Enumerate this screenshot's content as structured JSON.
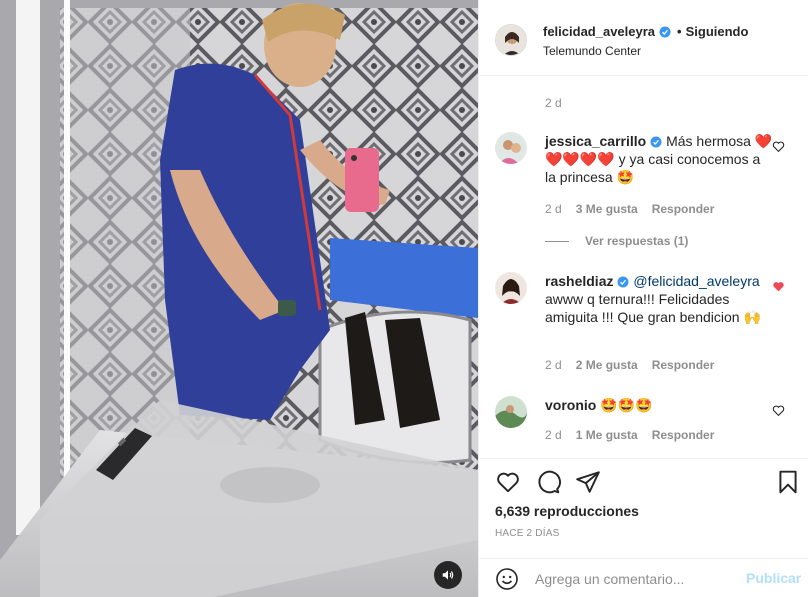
{
  "post": {
    "username": "felicidad_aveleyra",
    "separator": "•",
    "follow_status": "Siguiendo",
    "location": "Telemundo Center"
  },
  "comments_top_meta": {
    "time": "2 d"
  },
  "comments": [
    {
      "username": "jessica_carrillo",
      "text_before": "Más hermosa ",
      "emoji_line": "❤️❤️❤️❤️❤️",
      "text_after": " y ya casi conocemos a la princesa 🤩",
      "time": "2 d",
      "likes": "3 Me gusta",
      "reply": "Responder",
      "view_replies": "Ver respuestas (1)",
      "liked": false
    },
    {
      "username": "rasheldiaz",
      "mention": "@felicidad_aveleyra",
      "text": "awww q ternura!!! Felicidades amiguita !!! Que gran bendicion 🙌",
      "time": "2 d",
      "likes": "2 Me gusta",
      "reply": "Responder",
      "liked": true
    },
    {
      "username": "voronio",
      "text": "🤩🤩🤩",
      "time": "2 d",
      "likes": "1 Me gusta",
      "reply": "Responder",
      "liked": false
    }
  ],
  "stats": {
    "views": "6,639 reproducciones",
    "posted_ago": "HACE 2 DÍAS"
  },
  "composer": {
    "placeholder": "Agrega un comentario...",
    "publish_label": "Publicar"
  },
  "icons": {
    "like": "heart-outline-icon",
    "comment": "speech-bubble-icon",
    "share": "paper-plane-icon",
    "save": "bookmark-icon",
    "sound": "speaker-icon",
    "emoji": "smiley-icon",
    "verified": "verified-badge-icon"
  },
  "colors": {
    "verified_blue": "#3897f0",
    "liked_red": "#ed4956",
    "muted_text": "#8e8e8e",
    "publish_disabled": "#b2dffc",
    "mention_blue": "#00376b"
  }
}
